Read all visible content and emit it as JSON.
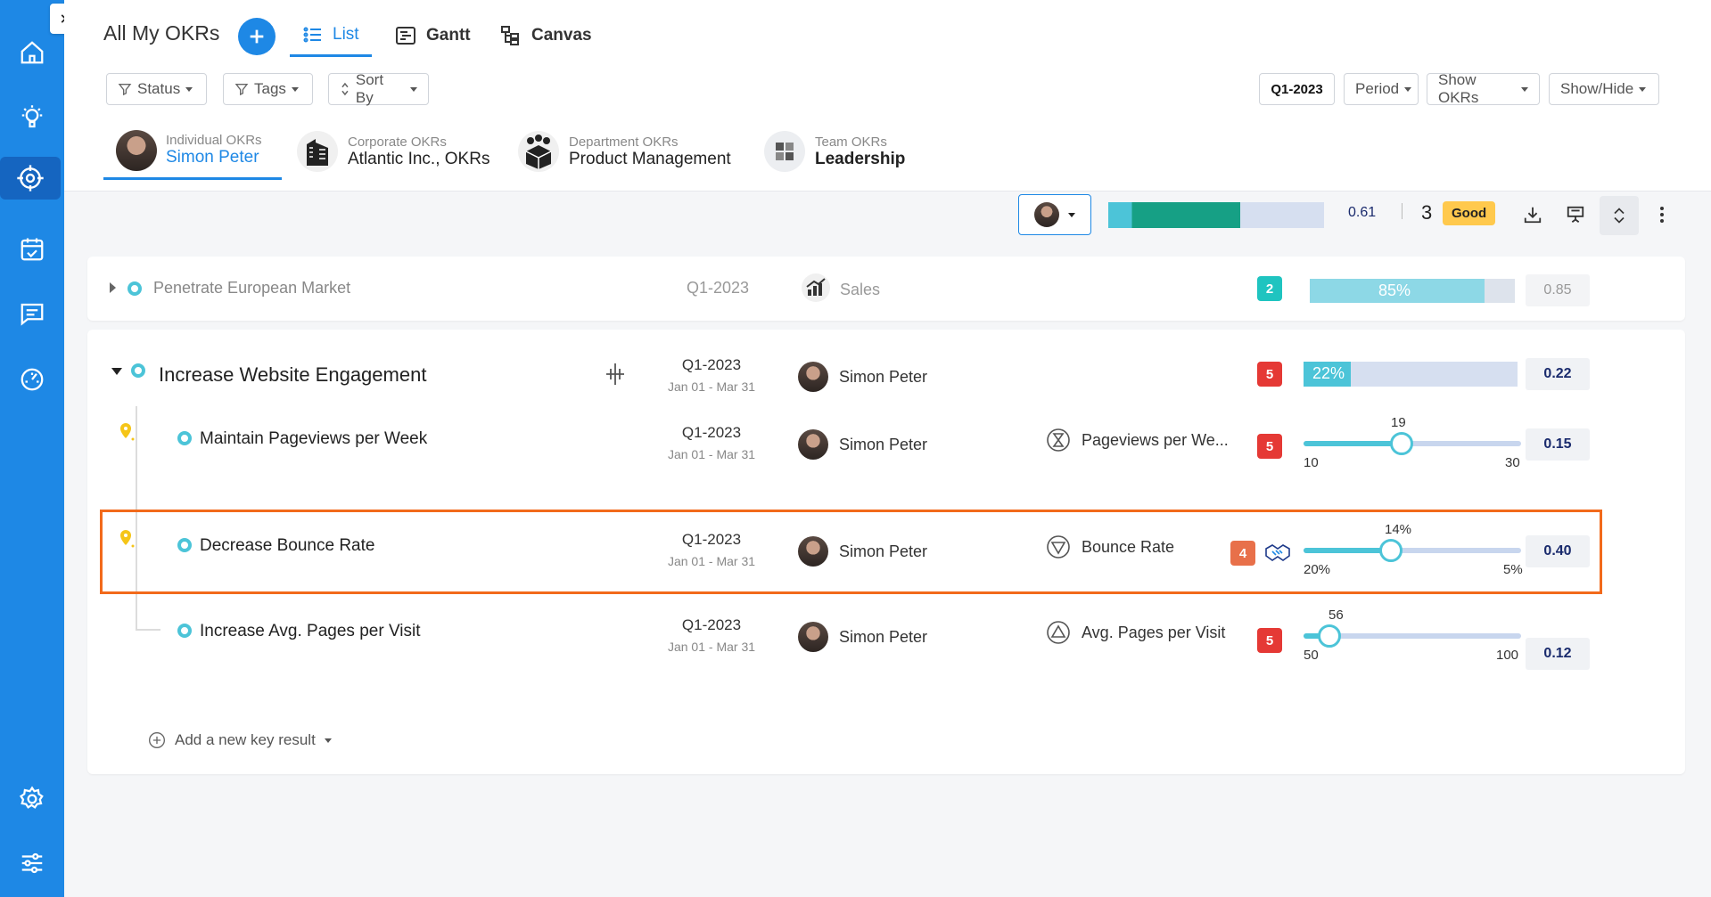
{
  "header": {
    "title": "All My OKRs",
    "views": [
      {
        "label": "List",
        "icon": "list-icon"
      },
      {
        "label": "Gantt",
        "icon": "gantt-icon"
      },
      {
        "label": "Canvas",
        "icon": "canvas-icon"
      }
    ],
    "filters": {
      "status": "Status",
      "tags": "Tags",
      "sort": "Sort By"
    },
    "right_filters": {
      "quarter": "Q1-2023",
      "period": "Period",
      "show_okrs": "Show OKRs",
      "show_hide": "Show/Hide"
    }
  },
  "okr_tabs": [
    {
      "small": "Individual OKRs",
      "big": "Simon Peter",
      "icon": "avatar"
    },
    {
      "small": "Corporate OKRs",
      "big": "Atlantic Inc., OKRs",
      "icon": "building-icon"
    },
    {
      "small": "Department OKRs",
      "big": "Product Management",
      "icon": "department-icon"
    },
    {
      "small": "Team OKRs",
      "big": "Leadership",
      "icon": "team-icon"
    }
  ],
  "toolbar": {
    "progress": 0.61,
    "score": "0.61",
    "count": "3",
    "status": "Good"
  },
  "objective1": {
    "title": "Penetrate European Market",
    "period": "Q1-2023",
    "team": "Sales",
    "badge": "2",
    "progress_label": "85%",
    "progress": 0.85,
    "score": "0.85"
  },
  "objective2": {
    "title": "Increase Website Engagement",
    "period": "Q1-2023",
    "dates": "Jan 01 - Mar 31",
    "owner": "Simon Peter",
    "badge": "5",
    "progress_label": "22%",
    "progress": 0.22,
    "score": "0.22",
    "key_results": [
      {
        "title": "Maintain Pageviews per Week",
        "period": "Q1-2023",
        "dates": "Jan 01 - Mar 31",
        "owner": "Simon Peter",
        "metric": "Pageviews per We...",
        "badge": "5",
        "current": "19",
        "start": "10",
        "target": "30",
        "progress": 0.45,
        "score": "0.15"
      },
      {
        "title": "Decrease Bounce Rate",
        "period": "Q1-2023",
        "dates": "Jan 01 - Mar 31",
        "owner": "Simon Peter",
        "metric": "Bounce Rate",
        "badge": "4",
        "current": "14%",
        "start": "20%",
        "target": "5%",
        "progress": 0.4,
        "score": "0.40"
      },
      {
        "title": "Increase Avg. Pages per Visit",
        "period": "Q1-2023",
        "dates": "Jan 01 - Mar 31",
        "owner": "Simon Peter",
        "metric": "Avg. Pages per Visit",
        "badge": "5",
        "current": "56",
        "start": "50",
        "target": "100",
        "progress": 0.12,
        "score": "0.12"
      }
    ],
    "add_kr": "Add a new key result"
  },
  "colors": {
    "primary": "#1e88e5",
    "teal": "#4cc4d8",
    "badge_red": "#e53935",
    "badge_orange": "#e8704a",
    "good": "#ffc94d",
    "highlight": "#f26a1b"
  }
}
